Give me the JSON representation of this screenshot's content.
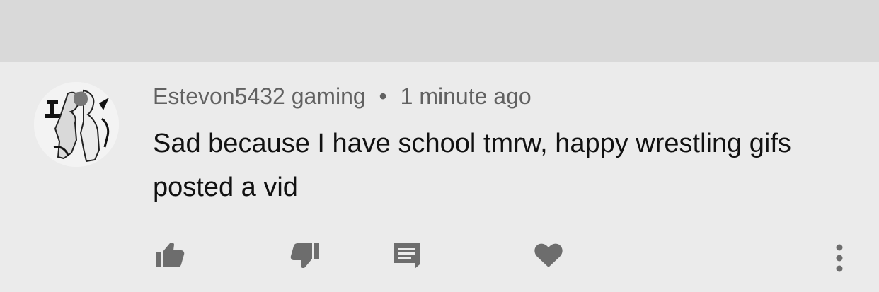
{
  "comment": {
    "author": "Estevon5432 gaming",
    "separator": "•",
    "time": "1 minute ago",
    "text": "Sad because I have school tmrw, happy wrestling gifs posted a vid"
  },
  "icons": {
    "like": "thumbs-up-icon",
    "dislike": "thumbs-down-icon",
    "reply": "comment-icon",
    "heart": "heart-icon",
    "more": "more-vert-icon"
  },
  "colors": {
    "background": "#ebebeb",
    "top_band": "#d9d9d9",
    "icon": "#6d6d6d",
    "meta_text": "#616161",
    "body_text": "#111111"
  }
}
